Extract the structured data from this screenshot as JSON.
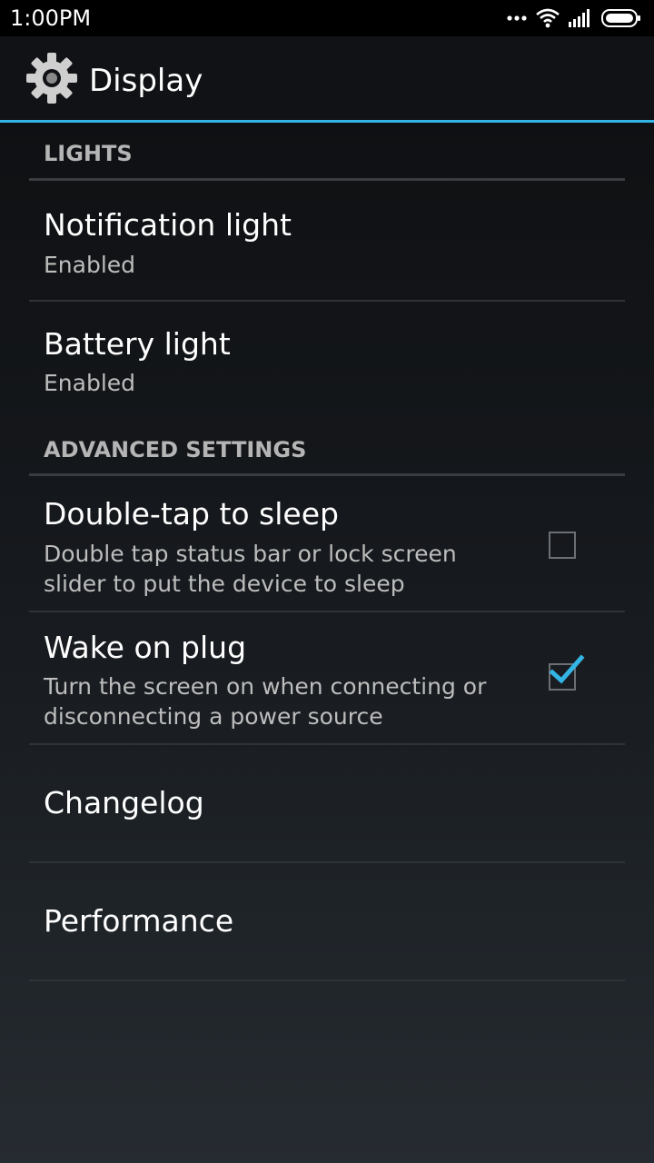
{
  "status_bar": {
    "time": "1:00PM",
    "icons": [
      "more-dots-icon",
      "wifi-icon",
      "cell-signal-icon",
      "battery-icon"
    ]
  },
  "action_bar": {
    "title": "Display",
    "icon": "gear-icon",
    "accent_color": "#33b5e5"
  },
  "sections": {
    "lights": {
      "header": "LIGHTS",
      "items": [
        {
          "title": "Notification light",
          "summary": "Enabled"
        },
        {
          "title": "Battery light",
          "summary": "Enabled"
        }
      ]
    },
    "advanced": {
      "header": "ADVANCED SETTINGS",
      "items": [
        {
          "title": "Double-tap to sleep",
          "summary": "Double tap status bar or lock screen slider to put the device to sleep",
          "checked": false
        },
        {
          "title": "Wake on plug",
          "summary": "Turn the screen on when connecting or disconnecting a power source",
          "checked": true
        }
      ]
    },
    "other": {
      "items": [
        {
          "title": "Changelog"
        },
        {
          "title": "Performance"
        }
      ]
    }
  }
}
